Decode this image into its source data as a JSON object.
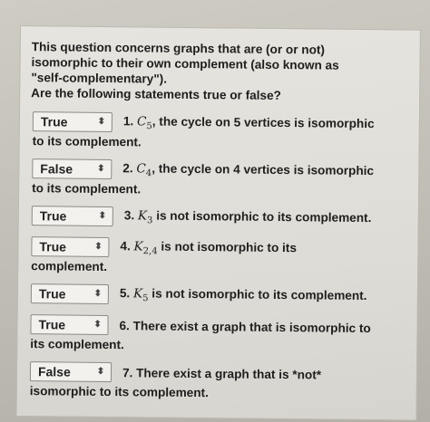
{
  "intro": {
    "line1": "This question concerns graphs that are (or or not)",
    "line2": "isomorphic to their own complement (also known as",
    "line3": "\"self-complementary\").",
    "line4": "Are the following statements true or false?"
  },
  "questions": [
    {
      "selected": "True",
      "num": "1.",
      "math": "C",
      "sub": "5",
      "rest": ", the cycle on 5 vertices is isomorphic",
      "cont": "to its complement."
    },
    {
      "selected": "False",
      "num": "2.",
      "math": "C",
      "sub": "4",
      "rest": ", the cycle on 4 vertices is isomorphic",
      "cont": "to its complement."
    },
    {
      "selected": "True",
      "num": "3.",
      "math": "K",
      "sub": "3",
      "rest": " is not isomorphic to its complement.",
      "cont": ""
    },
    {
      "selected": "True",
      "num": "4.",
      "math": "K",
      "sub": "2,4",
      "rest": " is not isomorphic to its",
      "cont": "complement."
    },
    {
      "selected": "True",
      "num": "5.",
      "math": "K",
      "sub": "5",
      "rest": " is not isomorphic to its complement.",
      "cont": ""
    },
    {
      "selected": "True",
      "num": "6.",
      "math": "",
      "sub": "",
      "rest": "There exist a graph that is isomorphic to",
      "cont": "its complement."
    },
    {
      "selected": "False",
      "num": "7.",
      "math": "",
      "sub": "",
      "rest": "There exist a graph that is *not*",
      "cont": "isomorphic to its complement."
    }
  ]
}
